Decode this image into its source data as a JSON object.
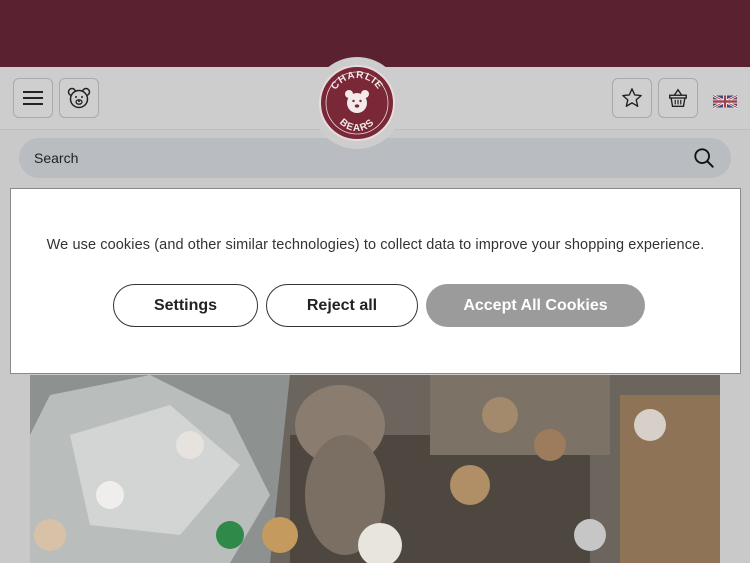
{
  "header": {
    "search_placeholder": "Search",
    "logo_text_top": "CHARLIE",
    "logo_text_bottom": "BEARS",
    "icons": [
      "menu-icon",
      "bear-icon",
      "star-icon",
      "basket-icon",
      "search-icon",
      "uk-flag-icon"
    ]
  },
  "cookie_banner": {
    "message": "We use cookies (and other similar technologies) to collect data to improve your shopping experience.",
    "settings_label": "Settings",
    "reject_label": "Reject all",
    "accept_label": "Accept All Cookies"
  },
  "colors": {
    "brand": "#5a2130",
    "accept_button": "#9b9b9b"
  }
}
